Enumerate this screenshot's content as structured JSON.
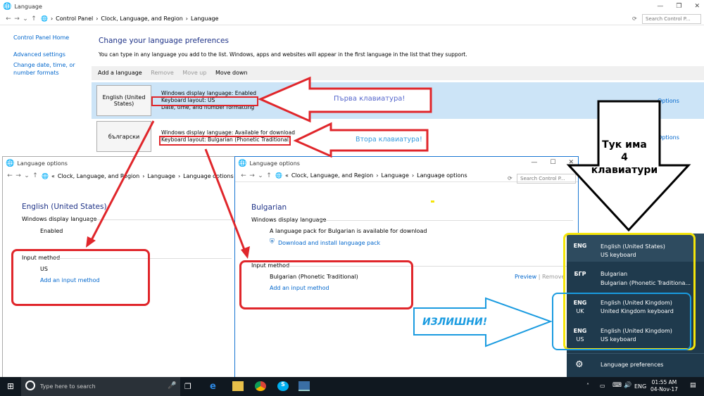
{
  "main": {
    "title": "Language",
    "breadcrumb": [
      "Control Panel",
      "Clock, Language, and Region",
      "Language"
    ],
    "search_placeholder": "Search Control P...",
    "sidebar": [
      "Control Panel Home",
      "Advanced settings",
      "Change date, time, or number formats"
    ],
    "heading": "Change your language preferences",
    "description": "You can type in any language you add to the list. Windows, apps and websites will appear in the first language in the list that they support.",
    "toolbar": {
      "add": "Add a language",
      "remove": "Remove",
      "move_up": "Move up",
      "move_down": "Move down"
    },
    "languages": [
      {
        "name": "English (United States)",
        "line1": "Windows display language: Enabled",
        "line2": "Keyboard layout: US",
        "line3": "Date, time, and number formatting",
        "options": "Options"
      },
      {
        "name": "български",
        "line1": "Windows display language: Available for download",
        "line2": "Keyboard layout: Bulgarian (Phonetic Traditional)",
        "options": "Options"
      }
    ]
  },
  "win1": {
    "title": "Language options",
    "breadcrumb": [
      "«",
      "Clock, Language, and Region",
      "Language",
      "Language options"
    ],
    "lang": "English (United States)",
    "display_label": "Windows display language",
    "display_value": "Enabled",
    "input_label": "Input method",
    "input_value": "US",
    "add_input": "Add an input method"
  },
  "win2": {
    "title": "Language options",
    "breadcrumb": [
      "«",
      "Clock, Language, and Region",
      "Language",
      "Language options"
    ],
    "search_placeholder": "Search Control P...",
    "lang": "Bulgarian",
    "display_label": "Windows display language",
    "pack_text": "A language pack for Bulgarian is available for download",
    "download_link": "Download and install language pack",
    "input_label": "Input method",
    "input_value": "Bulgarian (Phonetic Traditional)",
    "preview": "Preview",
    "sep": "|",
    "remove": "Remove",
    "add_input": "Add an input method"
  },
  "annotations": {
    "first_kb": "Първа клавиатура!",
    "second_kb": "Втора клавиатура!",
    "four_kb_l1": "Тук има",
    "four_kb_l2": "4",
    "four_kb_l3": "клавиатури",
    "extra": "ИЗЛИШНИ!"
  },
  "flyout": {
    "items": [
      {
        "code": "ENG",
        "code2": "",
        "name": "English (United States)",
        "kb": "US keyboard"
      },
      {
        "code": "БГР",
        "code2": "",
        "name": "Bulgarian",
        "kb": "Bulgarian (Phonetic Traditiona..."
      },
      {
        "code": "ENG",
        "code2": "UK",
        "name": "English (United Kingdom)",
        "kb": "United Kingdom keyboard"
      },
      {
        "code": "ENG",
        "code2": "US",
        "name": "English (United Kingdom)",
        "kb": "US keyboard"
      }
    ],
    "prefs": "Language preferences"
  },
  "taskbar": {
    "search": "Type here to search",
    "lang": "ENG",
    "time": "01:55 AM",
    "date": "04-Nov-17"
  },
  "colors": {
    "accent": "#0066cc",
    "red": "#e0262b",
    "yellow": "#f5e50a",
    "blue": "#1a9be0",
    "flyout": "#1f3a4d"
  }
}
